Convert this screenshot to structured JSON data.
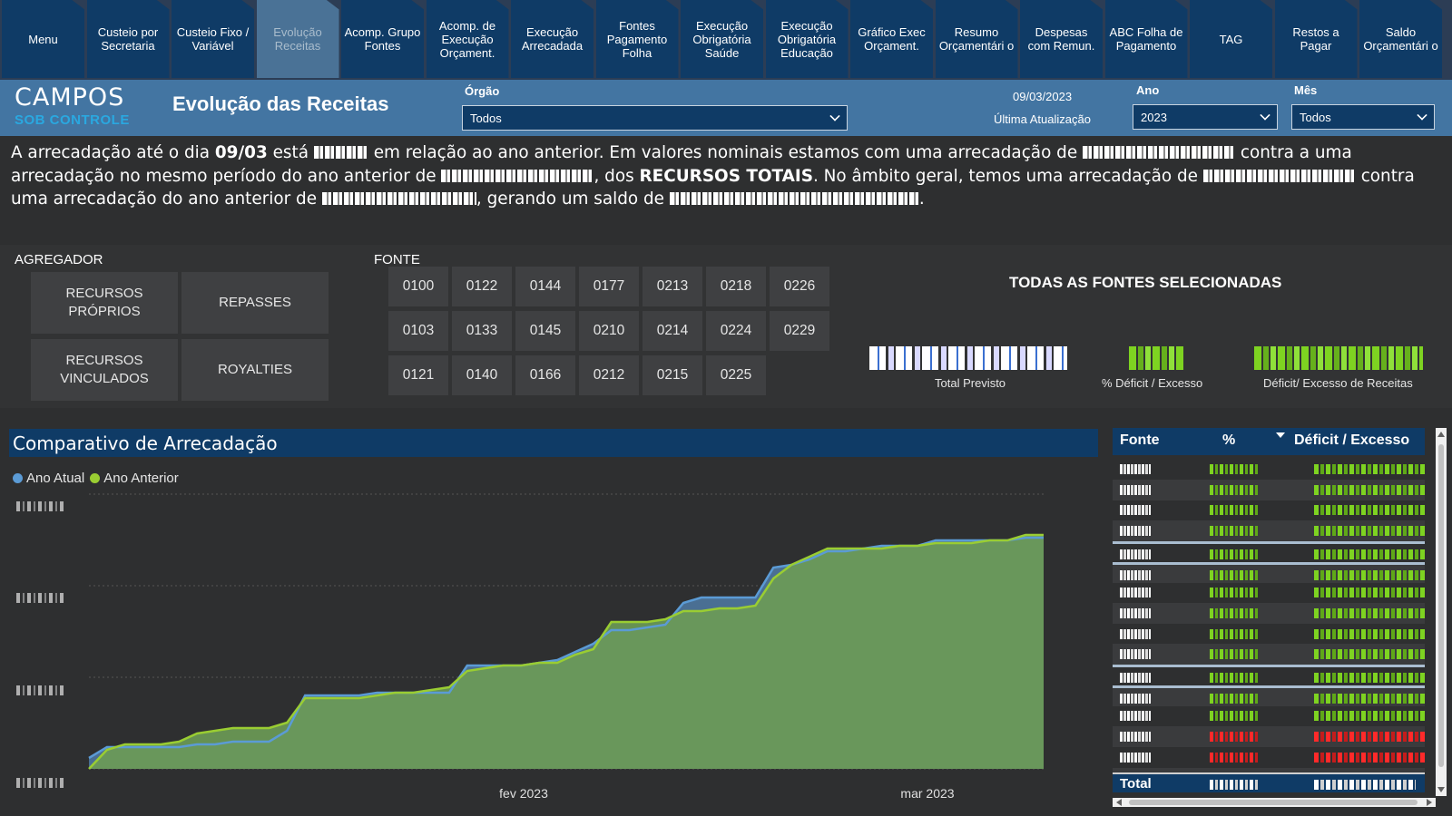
{
  "nav": [
    {
      "label": "Menu",
      "active": false
    },
    {
      "label": "Custeio por Secretaria",
      "active": false
    },
    {
      "label": "Custeio Fixo / Variável",
      "active": false
    },
    {
      "label": "Evolução Receitas",
      "active": true
    },
    {
      "label": "Acomp. Grupo Fontes",
      "active": false
    },
    {
      "label": "Acomp. de Execução Orçament.",
      "active": false
    },
    {
      "label": "Execução Arrecadada",
      "active": false
    },
    {
      "label": "Fontes Pagamento Folha",
      "active": false
    },
    {
      "label": "Execução Obrigatória Saúde",
      "active": false
    },
    {
      "label": "Execução Obrigatória Educação",
      "active": false
    },
    {
      "label": "Gráfico Exec Orçament.",
      "active": false
    },
    {
      "label": "Resumo Orçamentári o",
      "active": false
    },
    {
      "label": "Despesas com Remun.",
      "active": false
    },
    {
      "label": "ABC Folha de Pagamento",
      "active": false
    },
    {
      "label": "TAG",
      "active": false
    },
    {
      "label": "Restos a Pagar",
      "active": false
    },
    {
      "label": "Saldo Orçamentári o",
      "active": false
    }
  ],
  "header": {
    "logo_top": "CAMPOS",
    "logo_bottom": "SOB CONTROLE",
    "title": "Evolução das Receitas",
    "orgao_label": "Órgão",
    "orgao_value": "Todos",
    "update_date": "09/03/2023",
    "update_label": "Última Atualização",
    "ano_label": "Ano",
    "ano_value": "2023",
    "mes_label": "Mês",
    "mes_value": "Todos"
  },
  "summary": {
    "p1": "A arrecadação até o dia ",
    "date": "09/03",
    "p2": " está ",
    "p3": " em relação ao ano anterior. Em valores nominais estamos com uma arrecadação de ",
    "p4": " contra a uma arrecadação no mesmo período do ano anterior de ",
    "p5": ", dos ",
    "bold_total": "RECURSOS TOTAIS",
    "p6": ". No âmbito geral, temos uma arrecadação de ",
    "p7": " contra uma arrecadação do ano anterior de ",
    "p8": ", gerando um saldo de ",
    "p9": "."
  },
  "filters": {
    "agregador_label": "AGREGADOR",
    "agregador": [
      "RECURSOS PRÓPRIOS",
      "REPASSES",
      "RECURSOS VINCULADOS",
      "ROYALTIES"
    ],
    "fonte_label": "FONTE",
    "fontes": [
      [
        "0100",
        "0122",
        "0144",
        "0177",
        "0213",
        "0218",
        "0226"
      ],
      [
        "0103",
        "0133",
        "0145",
        "0210",
        "0214",
        "0224",
        "0229"
      ],
      [
        "0121",
        "0140",
        "0166",
        "0212",
        "0215",
        "0225"
      ]
    ]
  },
  "kpis": {
    "title": "TODAS AS FONTES SELECIONADAS",
    "total_previsto_label": "Total Previsto",
    "pct_label": "% Déficit / Excesso",
    "deficit_label": "Déficit/ Excesso de Receitas"
  },
  "chart_title": "Comparativo de Arrecadação",
  "chart_data": {
    "type": "area",
    "xlabels": [
      "fev 2023",
      "mar 2023"
    ],
    "series": [
      {
        "name": "Ano Atual",
        "color": "#5b9bd5",
        "values": [
          0.04,
          0.08,
          0.08,
          0.08,
          0.08,
          0.08,
          0.09,
          0.09,
          0.1,
          0.1,
          0.1,
          0.14,
          0.27,
          0.27,
          0.27,
          0.27,
          0.28,
          0.28,
          0.28,
          0.28,
          0.28,
          0.38,
          0.38,
          0.38,
          0.38,
          0.39,
          0.4,
          0.43,
          0.46,
          0.51,
          0.51,
          0.52,
          0.53,
          0.61,
          0.63,
          0.63,
          0.63,
          0.63,
          0.74,
          0.75,
          0.77,
          0.8,
          0.8,
          0.81,
          0.82,
          0.82,
          0.82,
          0.84,
          0.84,
          0.84,
          0.84,
          0.84,
          0.85,
          0.85
        ]
      },
      {
        "name": "Ano Anterior",
        "color": "#9acd32",
        "values": [
          0.0,
          0.07,
          0.09,
          0.09,
          0.09,
          0.1,
          0.13,
          0.14,
          0.15,
          0.15,
          0.15,
          0.17,
          0.26,
          0.26,
          0.26,
          0.26,
          0.27,
          0.28,
          0.28,
          0.29,
          0.3,
          0.36,
          0.37,
          0.38,
          0.38,
          0.39,
          0.39,
          0.42,
          0.44,
          0.54,
          0.54,
          0.54,
          0.55,
          0.58,
          0.58,
          0.59,
          0.59,
          0.6,
          0.7,
          0.75,
          0.78,
          0.81,
          0.81,
          0.81,
          0.81,
          0.82,
          0.82,
          0.83,
          0.83,
          0.83,
          0.84,
          0.84,
          0.86,
          0.86
        ]
      }
    ],
    "fill_color": "#6b9a56",
    "grid": true
  },
  "table": {
    "headers": [
      "Fonte",
      "%",
      "Déficit / Excesso"
    ],
    "rows": [
      {
        "sign": "pos",
        "alt": false,
        "sep": false
      },
      {
        "sign": "pos",
        "alt": true,
        "sep": false
      },
      {
        "sign": "pos",
        "alt": false,
        "sep": false
      },
      {
        "sign": "pos",
        "alt": true,
        "sep": false
      },
      {
        "sign": "pos",
        "alt": false,
        "sep": true
      },
      {
        "sign": "pos",
        "alt": true,
        "sep": true
      },
      {
        "sign": "pos",
        "alt": false,
        "sep": false
      },
      {
        "sign": "pos",
        "alt": true,
        "sep": false
      },
      {
        "sign": "pos",
        "alt": false,
        "sep": false
      },
      {
        "sign": "pos",
        "alt": true,
        "sep": false
      },
      {
        "sign": "pos",
        "alt": false,
        "sep": true
      },
      {
        "sign": "pos",
        "alt": true,
        "sep": true
      },
      {
        "sign": "pos",
        "alt": false,
        "sep": false
      },
      {
        "sign": "neg",
        "alt": true,
        "sep": false
      },
      {
        "sign": "neg",
        "alt": false,
        "sep": false
      },
      {
        "sign": "neg",
        "alt": true,
        "sep": false
      }
    ],
    "total_label": "Total"
  }
}
